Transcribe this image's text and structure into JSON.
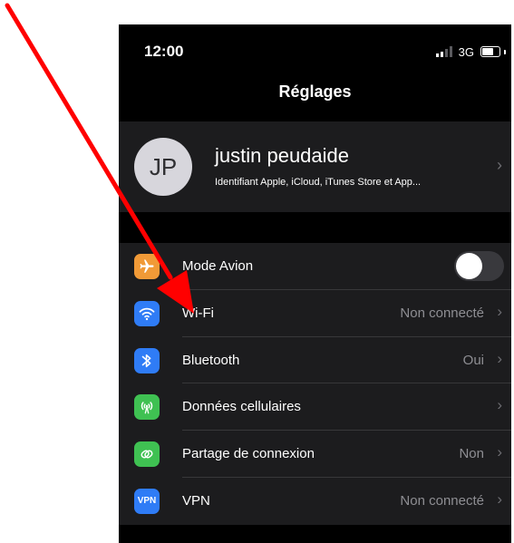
{
  "status_bar": {
    "time": "12:00",
    "network": "3G",
    "signal_bars_filled": 2,
    "signal_bars_total": 4
  },
  "nav": {
    "title": "Réglages"
  },
  "profile": {
    "initials": "JP",
    "name": "justin peudaide",
    "subtitle": "Identifiant Apple, iCloud, iTunes Store et App..."
  },
  "settings": [
    {
      "label": "Mode Avion",
      "value": "",
      "icon": "airplane-icon",
      "color": "#f19a37",
      "type": "toggle",
      "toggle_on": false
    },
    {
      "label": "Wi-Fi",
      "value": "Non connecté",
      "icon": "wifi-icon",
      "color": "#2f7cf6",
      "type": "chevron"
    },
    {
      "label": "Bluetooth",
      "value": "Oui",
      "icon": "bluetooth-icon",
      "color": "#2f7cf6",
      "type": "chevron"
    },
    {
      "label": "Données cellulaires",
      "value": "",
      "icon": "cellular-antenna-icon",
      "color": "#3fc152",
      "type": "chevron"
    },
    {
      "label": "Partage de connexion",
      "value": "Non",
      "icon": "hotspot-link-icon",
      "color": "#3fc152",
      "type": "chevron"
    },
    {
      "label": "VPN",
      "value": "Non connecté",
      "icon": "vpn-icon",
      "icon_text": "VPN",
      "color": "#2f7cf6",
      "type": "chevron"
    }
  ],
  "annotation": {
    "arrow_color": "#ff0000"
  }
}
